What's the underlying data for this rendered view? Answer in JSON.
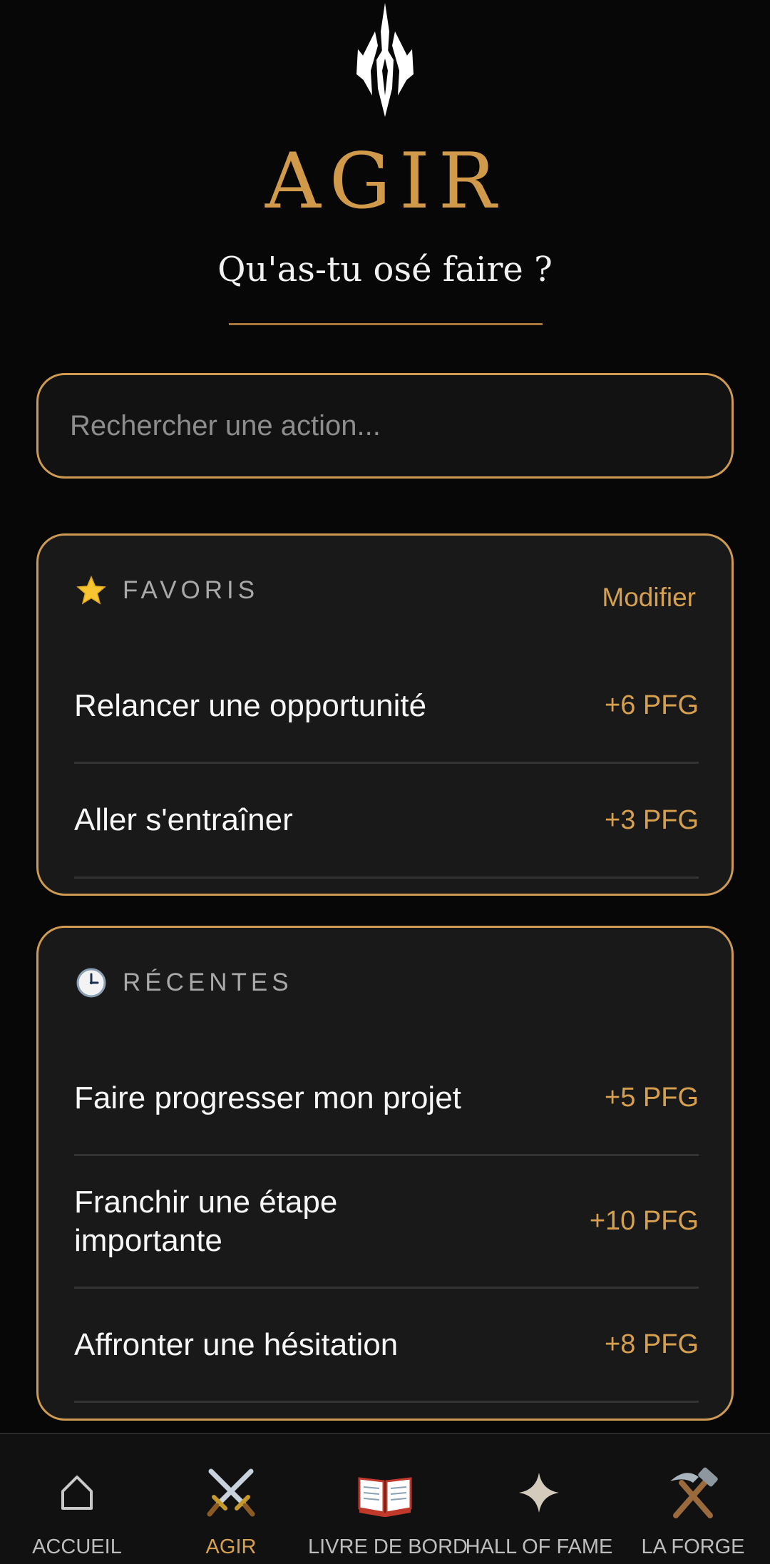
{
  "header": {
    "title": "AGIR",
    "subtitle": "Qu'as-tu osé faire ?"
  },
  "search": {
    "placeholder": "Rechercher une action...",
    "value": ""
  },
  "favoris": {
    "icon": "star-icon",
    "title": "FAVORIS",
    "edit_label": "Modifier",
    "items": [
      {
        "label": "Relancer une opportunité",
        "points": "+6 PFG"
      },
      {
        "label": "Aller s'entraîner",
        "points": "+3 PFG"
      }
    ]
  },
  "recentes": {
    "icon": "clock-icon",
    "title": "RÉCENTES",
    "items": [
      {
        "label": "Faire progresser mon projet",
        "points": "+5 PFG"
      },
      {
        "label": "Franchir une étape importante",
        "points": "+10 PFG"
      },
      {
        "label": "Affronter une hésitation",
        "points": "+8 PFG"
      }
    ]
  },
  "nav": {
    "active": "AGIR",
    "items": [
      {
        "label": "ACCUEIL",
        "icon": "home-icon"
      },
      {
        "label": "AGIR",
        "icon": "crossed-swords-icon"
      },
      {
        "label": "LIVRE DE BORD",
        "icon": "open-book-icon"
      },
      {
        "label": "HALL OF FAME",
        "icon": "sparkle-star-icon"
      },
      {
        "label": "LA FORGE",
        "icon": "hammer-pick-icon"
      }
    ]
  },
  "colors": {
    "gold": "#d19a4a",
    "background": "#070707",
    "card": "#191919"
  }
}
